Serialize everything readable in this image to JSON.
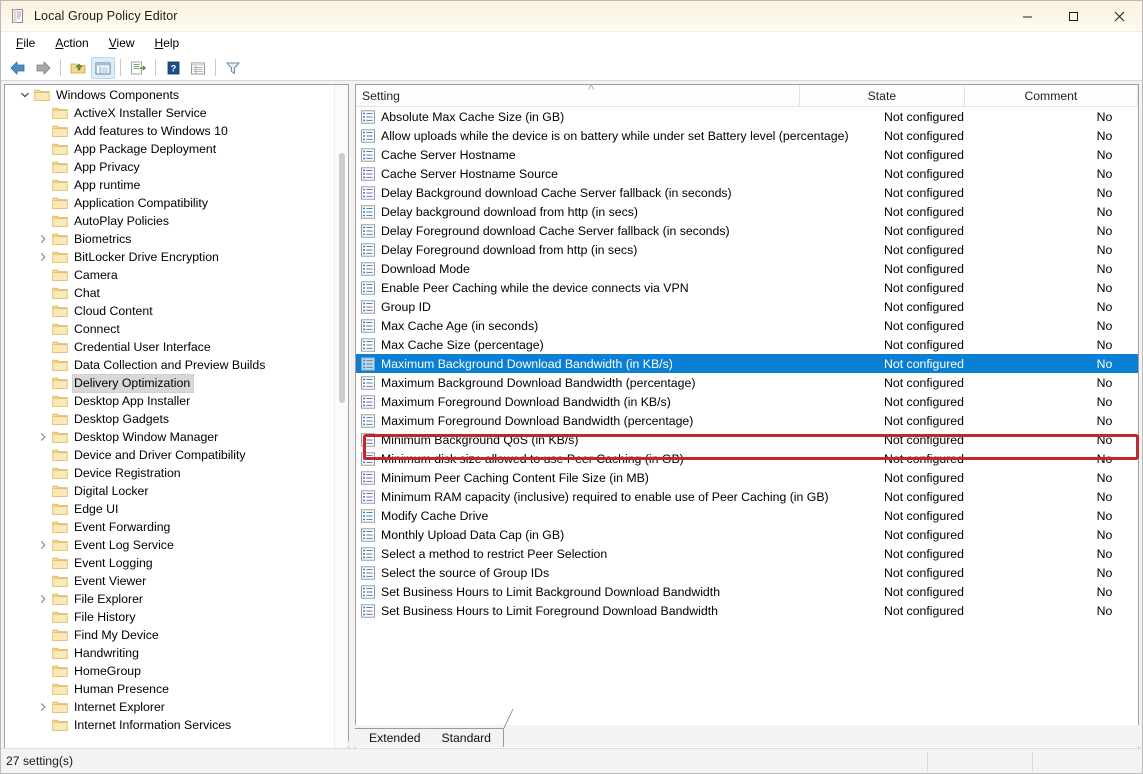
{
  "window": {
    "title": "Local Group Policy Editor",
    "icon": "gpedit-icon",
    "minimize_label": "—",
    "maximize_label": "□",
    "close_label": "✕"
  },
  "menubar": {
    "items": [
      {
        "label": "File",
        "accel": "F"
      },
      {
        "label": "Action",
        "accel": "A"
      },
      {
        "label": "View",
        "accel": "V"
      },
      {
        "label": "Help",
        "accel": "H"
      }
    ]
  },
  "toolbar": {
    "buttons": [
      {
        "name": "back-icon",
        "title": "Back"
      },
      {
        "name": "forward-icon",
        "title": "Forward"
      },
      {
        "name": "up-folder-icon",
        "title": "Up One Level"
      },
      {
        "name": "show-hide-tree-icon",
        "title": "Show/Hide Console Tree"
      },
      {
        "name": "export-list-icon",
        "title": "Export List"
      },
      {
        "name": "help-icon",
        "title": "Help"
      },
      {
        "name": "properties-icon",
        "title": "Properties"
      },
      {
        "name": "filter-icon",
        "title": "Filter"
      }
    ]
  },
  "tree": {
    "items": [
      {
        "label": "Windows Components",
        "depth": 0,
        "expander": "open",
        "selected": false
      },
      {
        "label": "ActiveX Installer Service",
        "depth": 1,
        "expander": "none",
        "selected": false
      },
      {
        "label": "Add features to Windows 10",
        "depth": 1,
        "expander": "none",
        "selected": false
      },
      {
        "label": "App Package Deployment",
        "depth": 1,
        "expander": "none",
        "selected": false
      },
      {
        "label": "App Privacy",
        "depth": 1,
        "expander": "none",
        "selected": false
      },
      {
        "label": "App runtime",
        "depth": 1,
        "expander": "none",
        "selected": false
      },
      {
        "label": "Application Compatibility",
        "depth": 1,
        "expander": "none",
        "selected": false
      },
      {
        "label": "AutoPlay Policies",
        "depth": 1,
        "expander": "none",
        "selected": false
      },
      {
        "label": "Biometrics",
        "depth": 1,
        "expander": "closed",
        "selected": false
      },
      {
        "label": "BitLocker Drive Encryption",
        "depth": 1,
        "expander": "closed",
        "selected": false
      },
      {
        "label": "Camera",
        "depth": 1,
        "expander": "none",
        "selected": false
      },
      {
        "label": "Chat",
        "depth": 1,
        "expander": "none",
        "selected": false
      },
      {
        "label": "Cloud Content",
        "depth": 1,
        "expander": "none",
        "selected": false
      },
      {
        "label": "Connect",
        "depth": 1,
        "expander": "none",
        "selected": false
      },
      {
        "label": "Credential User Interface",
        "depth": 1,
        "expander": "none",
        "selected": false
      },
      {
        "label": "Data Collection and Preview Builds",
        "depth": 1,
        "expander": "none",
        "selected": false
      },
      {
        "label": "Delivery Optimization",
        "depth": 1,
        "expander": "none",
        "selected": true
      },
      {
        "label": "Desktop App Installer",
        "depth": 1,
        "expander": "none",
        "selected": false
      },
      {
        "label": "Desktop Gadgets",
        "depth": 1,
        "expander": "none",
        "selected": false
      },
      {
        "label": "Desktop Window Manager",
        "depth": 1,
        "expander": "closed",
        "selected": false
      },
      {
        "label": "Device and Driver Compatibility",
        "depth": 1,
        "expander": "none",
        "selected": false
      },
      {
        "label": "Device Registration",
        "depth": 1,
        "expander": "none",
        "selected": false
      },
      {
        "label": "Digital Locker",
        "depth": 1,
        "expander": "none",
        "selected": false
      },
      {
        "label": "Edge UI",
        "depth": 1,
        "expander": "none",
        "selected": false
      },
      {
        "label": "Event Forwarding",
        "depth": 1,
        "expander": "none",
        "selected": false
      },
      {
        "label": "Event Log Service",
        "depth": 1,
        "expander": "closed",
        "selected": false
      },
      {
        "label": "Event Logging",
        "depth": 1,
        "expander": "none",
        "selected": false
      },
      {
        "label": "Event Viewer",
        "depth": 1,
        "expander": "none",
        "selected": false
      },
      {
        "label": "File Explorer",
        "depth": 1,
        "expander": "closed",
        "selected": false
      },
      {
        "label": "File History",
        "depth": 1,
        "expander": "none",
        "selected": false
      },
      {
        "label": "Find My Device",
        "depth": 1,
        "expander": "none",
        "selected": false
      },
      {
        "label": "Handwriting",
        "depth": 1,
        "expander": "none",
        "selected": false
      },
      {
        "label": "HomeGroup",
        "depth": 1,
        "expander": "none",
        "selected": false
      },
      {
        "label": "Human Presence",
        "depth": 1,
        "expander": "none",
        "selected": false
      },
      {
        "label": "Internet Explorer",
        "depth": 1,
        "expander": "closed",
        "selected": false
      },
      {
        "label": "Internet Information Services",
        "depth": 1,
        "expander": "none",
        "selected": false
      }
    ]
  },
  "listview": {
    "columns": [
      {
        "label": "Setting",
        "align": "left"
      },
      {
        "label": "State",
        "align": "center"
      },
      {
        "label": "Comment",
        "align": "center"
      }
    ],
    "sort_indicator": "˄",
    "rows": [
      {
        "setting": "Absolute Max Cache Size (in GB)",
        "state": "Not configured",
        "comment": "No",
        "selected": false
      },
      {
        "setting": "Allow uploads while the device is on battery while under set Battery level (percentage)",
        "state": "Not configured",
        "comment": "No",
        "selected": false
      },
      {
        "setting": "Cache Server Hostname",
        "state": "Not configured",
        "comment": "No",
        "selected": false
      },
      {
        "setting": "Cache Server Hostname Source",
        "state": "Not configured",
        "comment": "No",
        "selected": false
      },
      {
        "setting": "Delay Background download Cache Server fallback (in seconds)",
        "state": "Not configured",
        "comment": "No",
        "selected": false
      },
      {
        "setting": "Delay background download from http (in secs)",
        "state": "Not configured",
        "comment": "No",
        "selected": false
      },
      {
        "setting": "Delay Foreground download Cache Server fallback (in seconds)",
        "state": "Not configured",
        "comment": "No",
        "selected": false
      },
      {
        "setting": "Delay Foreground download from http (in secs)",
        "state": "Not configured",
        "comment": "No",
        "selected": false
      },
      {
        "setting": "Download Mode",
        "state": "Not configured",
        "comment": "No",
        "selected": false
      },
      {
        "setting": "Enable Peer Caching while the device connects via VPN",
        "state": "Not configured",
        "comment": "No",
        "selected": false
      },
      {
        "setting": "Group ID",
        "state": "Not configured",
        "comment": "No",
        "selected": false
      },
      {
        "setting": "Max Cache Age (in seconds)",
        "state": "Not configured",
        "comment": "No",
        "selected": false
      },
      {
        "setting": "Max Cache Size (percentage)",
        "state": "Not configured",
        "comment": "No",
        "selected": false
      },
      {
        "setting": "Maximum Background Download Bandwidth (in KB/s)",
        "state": "Not configured",
        "comment": "No",
        "selected": true
      },
      {
        "setting": "Maximum Background Download Bandwidth (percentage)",
        "state": "Not configured",
        "comment": "No",
        "selected": false
      },
      {
        "setting": "Maximum Foreground Download Bandwidth (in KB/s)",
        "state": "Not configured",
        "comment": "No",
        "selected": false
      },
      {
        "setting": "Maximum Foreground Download Bandwidth (percentage)",
        "state": "Not configured",
        "comment": "No",
        "selected": false
      },
      {
        "setting": "Minimum Background QoS (in KB/s)",
        "state": "Not configured",
        "comment": "No",
        "selected": false
      },
      {
        "setting": "Minimum disk size allowed to use Peer Caching (in GB)",
        "state": "Not configured",
        "comment": "No",
        "selected": false
      },
      {
        "setting": "Minimum Peer Caching Content File Size (in MB)",
        "state": "Not configured",
        "comment": "No",
        "selected": false
      },
      {
        "setting": "Minimum RAM capacity (inclusive) required to enable use of Peer Caching (in GB)",
        "state": "Not configured",
        "comment": "No",
        "selected": false
      },
      {
        "setting": "Modify Cache Drive",
        "state": "Not configured",
        "comment": "No",
        "selected": false
      },
      {
        "setting": "Monthly Upload Data Cap (in GB)",
        "state": "Not configured",
        "comment": "No",
        "selected": false
      },
      {
        "setting": "Select a method to restrict Peer Selection",
        "state": "Not configured",
        "comment": "No",
        "selected": false
      },
      {
        "setting": "Select the source of Group IDs",
        "state": "Not configured",
        "comment": "No",
        "selected": false
      },
      {
        "setting": "Set Business Hours to Limit Background Download Bandwidth",
        "state": "Not configured",
        "comment": "No",
        "selected": false
      },
      {
        "setting": "Set Business Hours to Limit Foreground Download Bandwidth",
        "state": "Not configured",
        "comment": "No",
        "selected": false
      }
    ]
  },
  "tabs": [
    {
      "label": "Extended",
      "active": false
    },
    {
      "label": "Standard",
      "active": true
    }
  ],
  "statusbar": {
    "text": "27 setting(s)"
  },
  "annotation": {
    "color": "#c4262e",
    "target": "Maximum Background Download Bandwidth (in KB/s)"
  },
  "colors": {
    "selection_blue": "#0a7fd4",
    "titlebar_cream": "#fbf3e0",
    "annotation_red": "#c4262e"
  }
}
